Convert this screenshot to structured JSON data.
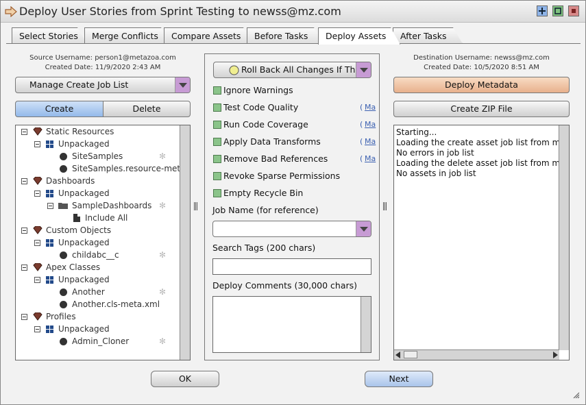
{
  "window": {
    "title": "Deploy User Stories from Sprint Testing to newss@mz.com",
    "controls": [
      "maximize-icon",
      "restore-icon",
      "close-icon"
    ]
  },
  "tabs": [
    {
      "label": "Select Stories"
    },
    {
      "label": "Merge Conflicts"
    },
    {
      "label": "Compare Assets"
    },
    {
      "label": "Before Tasks"
    },
    {
      "label": "Deploy Assets",
      "active": true
    },
    {
      "label": "After Tasks"
    }
  ],
  "left": {
    "source_username": "Source Username: person1@metazoa.com",
    "created_date": "Created Date: 11/9/2020 2:43 AM",
    "job_list_select": "Manage Create Job List",
    "create_label": "Create",
    "delete_label": "Delete",
    "tree": [
      {
        "label": "Static Resources"
      },
      {
        "label": "Unpackaged"
      },
      {
        "label": "SiteSamples"
      },
      {
        "label": "SiteSamples.resource-meta"
      },
      {
        "label": "Dashboards"
      },
      {
        "label": "Unpackaged"
      },
      {
        "label": "SampleDashboards"
      },
      {
        "label": "Include All"
      },
      {
        "label": "Custom Objects"
      },
      {
        "label": "Unpackaged"
      },
      {
        "label": "childabc__c"
      },
      {
        "label": "Apex Classes"
      },
      {
        "label": "Unpackaged"
      },
      {
        "label": "Another"
      },
      {
        "label": "Another.cls-meta.xml"
      },
      {
        "label": "Profiles"
      },
      {
        "label": "Unpackaged"
      },
      {
        "label": "Admin_Cloner"
      }
    ]
  },
  "middle": {
    "rollback_select": "Roll Back All Changes If There",
    "options": [
      {
        "label": "Ignore Warnings",
        "link": ""
      },
      {
        "label": "Test Code Quality",
        "link": "Ma"
      },
      {
        "label": "Run Code Coverage",
        "link": "Ma"
      },
      {
        "label": "Apply Data Transforms",
        "link": "Ma"
      },
      {
        "label": "Remove Bad References",
        "link": "Ma"
      },
      {
        "label": "Revoke Sparse Permissions",
        "link": ""
      },
      {
        "label": "Empty Recycle Bin",
        "link": ""
      }
    ],
    "paren": "(",
    "job_name_label": "Job Name (for reference)",
    "job_name_value": "",
    "search_tags_label": "Search Tags (200 chars)",
    "search_tags_value": "",
    "deploy_comments_label": "Deploy Comments (30,000 chars)",
    "deploy_comments_value": ""
  },
  "right": {
    "dest_username": "Destination Username: newss@mz.com",
    "created_date": "Created Date: 10/5/2020 8:51 AM",
    "deploy_metadata_label": "Deploy Metadata",
    "create_zip_label": "Create ZIP File",
    "log": [
      "Starting...",
      "Loading the create asset job list from merc",
      "No errors in job list",
      "Loading the delete asset job list from merc",
      "No assets in job list"
    ]
  },
  "footer": {
    "ok_label": "OK",
    "next_label": "Next"
  },
  "colors": {
    "checkbox": "#8bc48a",
    "dropdown_accent": "#c79bd4",
    "deploy_button": "#f0c8a8",
    "next_button": "#bcd4f0",
    "create_active": "#a8c8f0"
  }
}
